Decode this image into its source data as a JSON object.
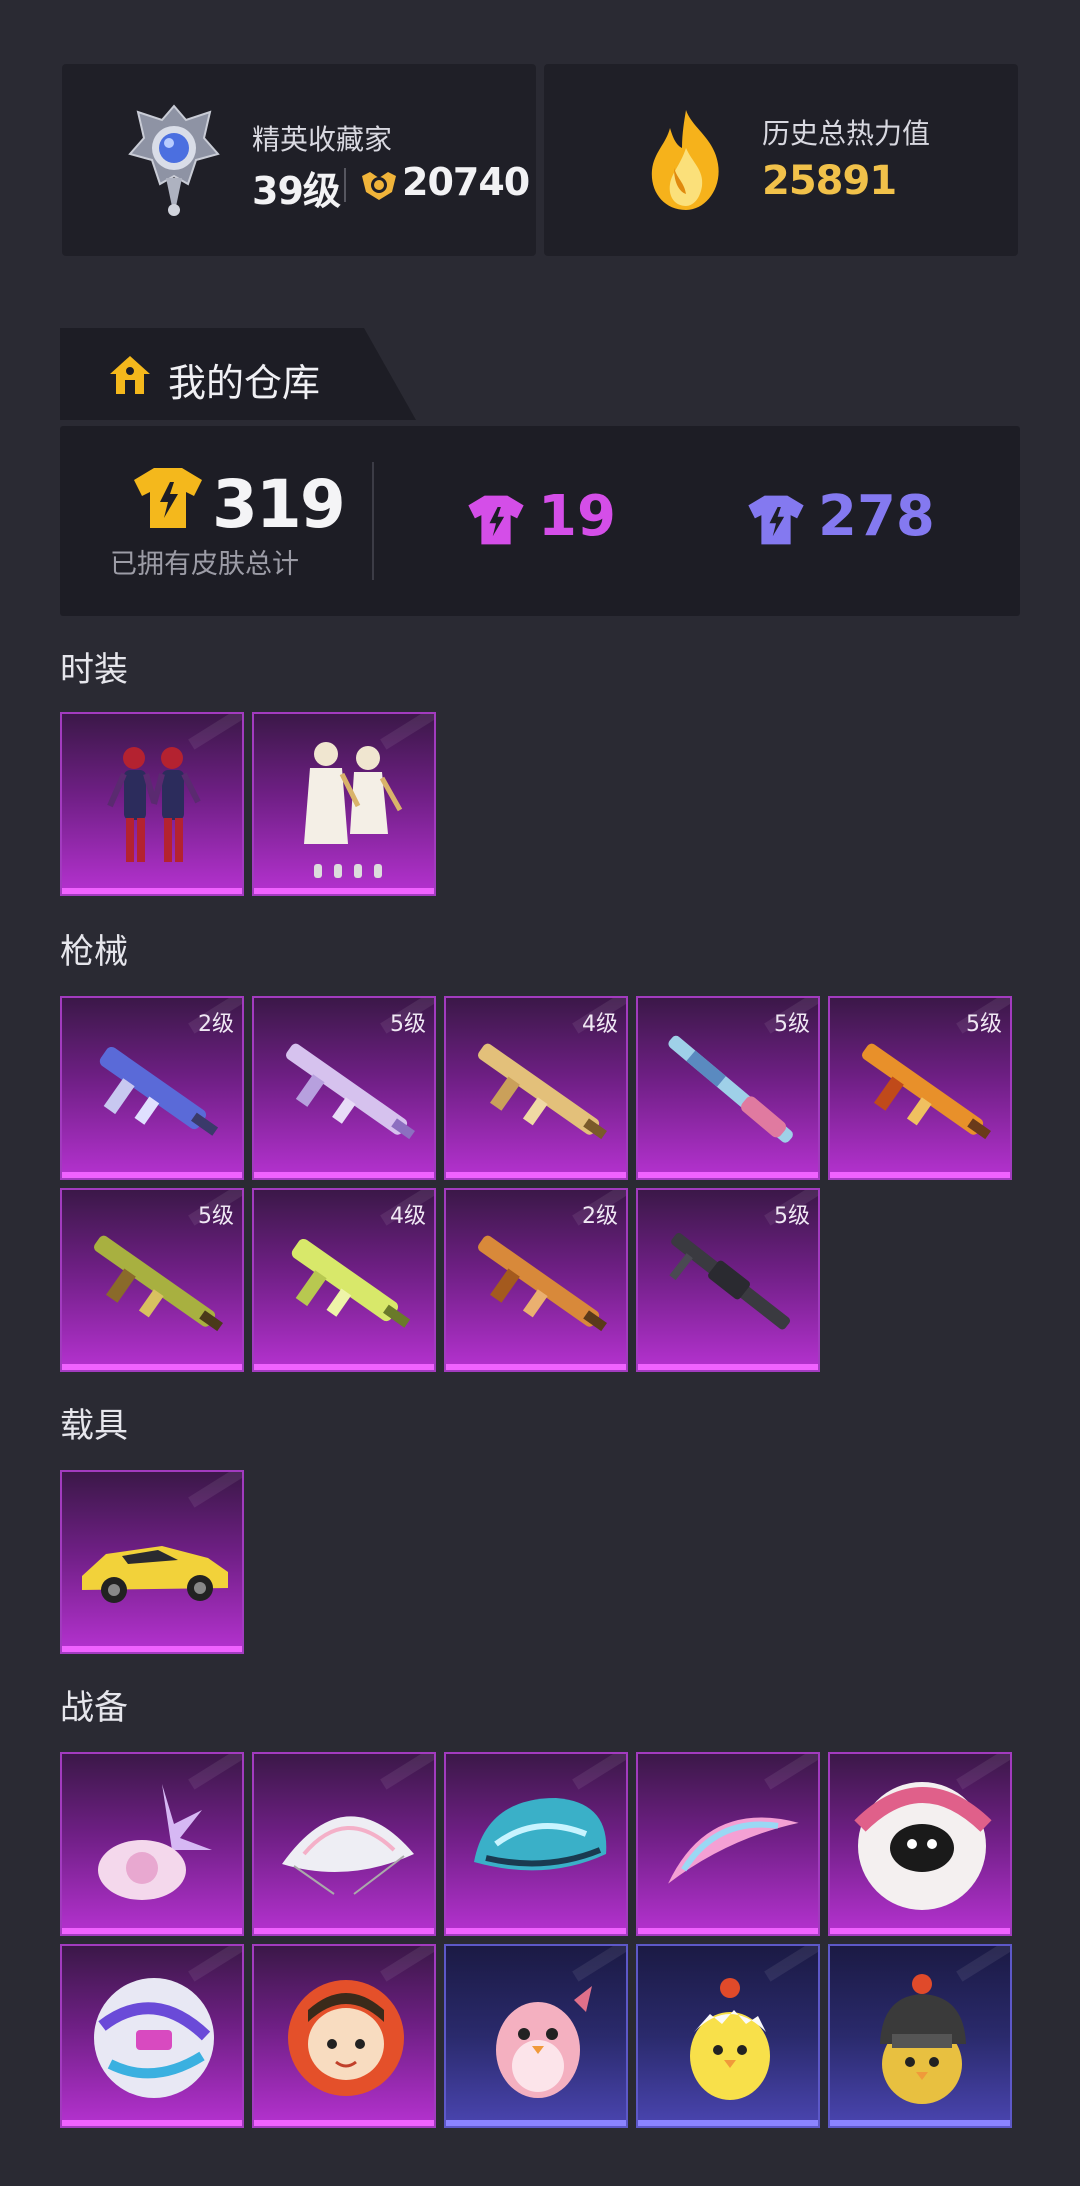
{
  "profile": {
    "collector_title": "精英收藏家",
    "level": "39级",
    "coins": "20740",
    "heat_title": "历史总热力值",
    "heat_value": "25891"
  },
  "warehouse": {
    "tab_label": "我的仓库",
    "total_value": "319",
    "total_label": "已拥有皮肤总计",
    "purple_value": "19",
    "blue_value": "278"
  },
  "sections": {
    "outfit": "时装",
    "guns": "枪械",
    "vehicles": "载具",
    "gear": "战备"
  },
  "outfit_items": [
    {
      "name": "red-costume-pair-item"
    },
    {
      "name": "white-costume-pair-item"
    }
  ],
  "gun_items": [
    {
      "level": "2级",
      "name": "blue-camo-smg-item"
    },
    {
      "level": "5级",
      "name": "pastel-rifle-item"
    },
    {
      "level": "4级",
      "name": "gold-ak-item"
    },
    {
      "level": "5级",
      "name": "painted-shotgun-item"
    },
    {
      "level": "5级",
      "name": "flame-rifle-item"
    },
    {
      "level": "5级",
      "name": "green-gold-rifle-item"
    },
    {
      "level": "4级",
      "name": "lime-smg-item"
    },
    {
      "level": "2级",
      "name": "orange-rifle-item"
    },
    {
      "level": "5级",
      "name": "black-lmg-item"
    }
  ],
  "vehicle_items": [
    {
      "name": "yellow-sports-car-item"
    }
  ],
  "gear_items": [
    {
      "name": "crystal-bag-item"
    },
    {
      "name": "white-parachute-item"
    },
    {
      "name": "blue-helmet-item"
    },
    {
      "name": "pink-glider-item"
    },
    {
      "name": "black-cat-parachute-item"
    },
    {
      "name": "graffiti-parachute-item"
    },
    {
      "name": "face-parachute-item"
    },
    {
      "name": "pink-bird-pet-item"
    },
    {
      "name": "yellow-chick-pet-item"
    },
    {
      "name": "helmet-chick-pet-item"
    }
  ],
  "colors": {
    "heat": "#f1c14a",
    "purple": "#d44ee8",
    "blue": "#8479f0",
    "gold": "#f4b81c"
  }
}
